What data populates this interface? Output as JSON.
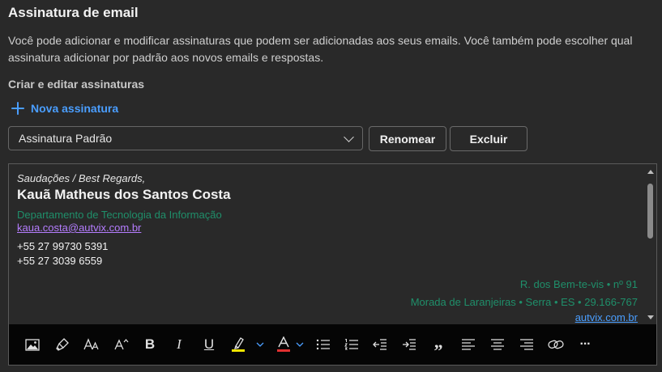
{
  "header": {
    "title": "Assinatura de email",
    "description": "Você pode adicionar e modificar assinaturas que podem ser adicionadas aos seus emails. Você também pode escolher qual assinatura adicionar por padrão aos novos emails e respostas.",
    "section_label": "Criar e editar assinaturas"
  },
  "actions": {
    "new_signature": "Nova assinatura",
    "selected_signature": "Assinatura Padrão",
    "rename": "Renomear",
    "delete": "Excluir"
  },
  "signature": {
    "greeting": "Saudações / Best Regards,",
    "name": "Kauã Matheus dos Santos Costa",
    "department": "Departamento de Tecnologia da Informação",
    "email": "kaua.costa@autvix.com.br",
    "phone1": "+55 27 99730 5391",
    "phone2": "+55 27 3039 6559",
    "address1": "R. dos Bem-te-vis • nº 91",
    "address2": "Morada de Laranjeiras • Serra • ES • 29.166-767",
    "website": "autvix.com.br"
  },
  "toolbar": {
    "icons": [
      "insert-picture-icon",
      "format-painter-icon",
      "font-size-icon",
      "superscript-size-icon",
      "bold-icon",
      "italic-icon",
      "underline-icon",
      "highlight-icon",
      "font-color-icon",
      "bullets-icon",
      "numbering-icon",
      "decrease-indent-icon",
      "increase-indent-icon",
      "quote-icon",
      "align-left-icon",
      "align-center-icon",
      "align-right-icon",
      "link-icon",
      "more-icon"
    ],
    "bold": "B",
    "italic": "I",
    "underline": "U",
    "quote": "”",
    "more": "···",
    "highlight_color": "#f2e600",
    "font_color": "#e03030"
  },
  "colors": {
    "background": "#292929",
    "accent": "#4a9eff",
    "department_text": "#1f8f6a",
    "email_link": "#b57dff"
  }
}
